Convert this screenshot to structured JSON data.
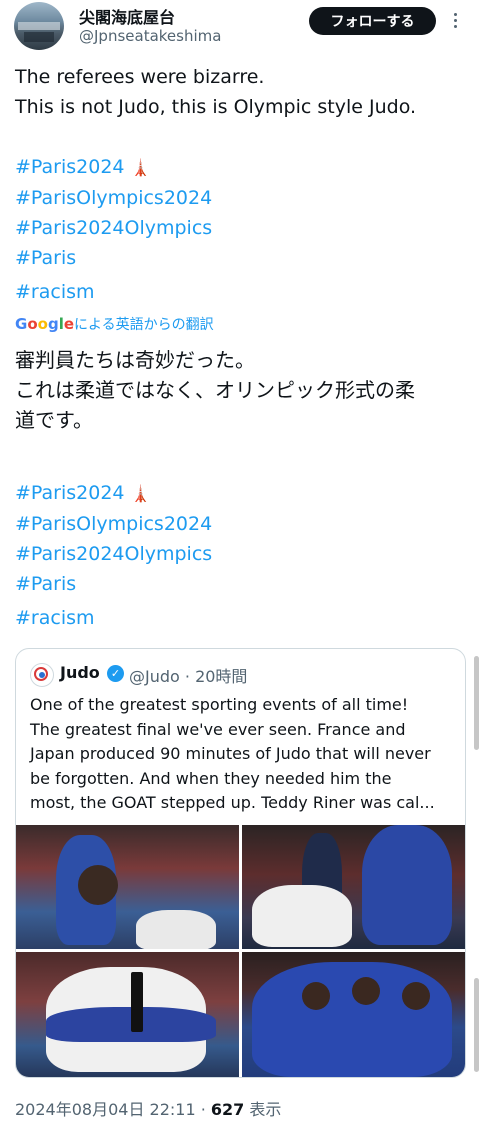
{
  "author": {
    "display_name": "尖閣海底屋台",
    "handle": "@Jpnseatakeshima"
  },
  "follow_button": "フォローする",
  "tweet": {
    "lines": [
      "The referees were bizarre.",
      "This is not Judo, this is Olympic style Judo."
    ],
    "hashtags": [
      "#Paris2024",
      "#ParisOlympics2024",
      "#Paris2024Olympics",
      "#Paris",
      "#racism"
    ],
    "eiffel_emoji": "🗼"
  },
  "translation": {
    "google_logo": [
      "G",
      "o",
      "o",
      "g",
      "l",
      "e"
    ],
    "label": "による英語からの翻訳",
    "lines": [
      "審判員たちは奇妙だった。",
      "これは柔道ではなく、オリンピック形式の柔",
      "道です。"
    ]
  },
  "quoted_tweet": {
    "name": "Judo",
    "handle_time": "@Judo · 20時間",
    "verified_icon": "✓",
    "lines": [
      "One of the greatest sporting events of all time!",
      "The greatest final we've ever seen. France and",
      "Japan produced 90 minutes of Judo that will never",
      "be forgotten. And when they needed him the",
      "most, the GOAT stepped up. Teddy Riner was cal..."
    ]
  },
  "footer": {
    "datetime": "2024年08月04日 22:11 · ",
    "views_count": "627",
    "views_label": " 表示"
  }
}
